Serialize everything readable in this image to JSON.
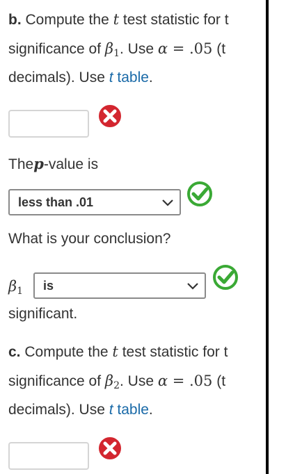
{
  "part_b": {
    "letter": "b.",
    "line1": " Compute the ",
    "t_symbol": "t",
    "line1_rest": " test statistic for t",
    "line2_a": "significance of ",
    "beta": "β",
    "beta_sub": "1",
    "line2_b": ". Use ",
    "alpha": "α",
    "equals": " = ",
    "alpha_value": ".05",
    "line2_c": " (t",
    "line3_a": "decimals). Use ",
    "link_t": "t",
    "link_table": " table",
    "line3_end": ".",
    "answer_value": "",
    "answer_status": "incorrect"
  },
  "pvalue": {
    "prefix": "The",
    "p_symbol": "p",
    "suffix": "-value is",
    "select_value": "less than .01",
    "status": "correct"
  },
  "conclusion": {
    "question": "What is your conclusion?",
    "beta": "β",
    "beta_sub": "1",
    "select_value": "is",
    "status": "correct",
    "after_text": "significant."
  },
  "part_c": {
    "letter": "c.",
    "line1": " Compute the ",
    "t_symbol": "t",
    "line1_rest": " test statistic for t",
    "line2_a": "significance of ",
    "beta": "β",
    "beta_sub": "2",
    "line2_b": ". Use ",
    "alpha": "α",
    "equals": " = ",
    "alpha_value": ".05",
    "line2_c": " (t",
    "line3_a": "decimals). Use ",
    "link_t": "t",
    "link_table": " table",
    "line3_end": ".",
    "answer_value": "",
    "answer_status": "incorrect"
  },
  "icons": {
    "incorrect": "x-circle-icon",
    "correct": "check-circle-icon"
  },
  "colors": {
    "incorrect_red": "#d3262f",
    "correct_green": "#3aa935",
    "link_blue": "#1a6aa8",
    "text": "#333333"
  }
}
